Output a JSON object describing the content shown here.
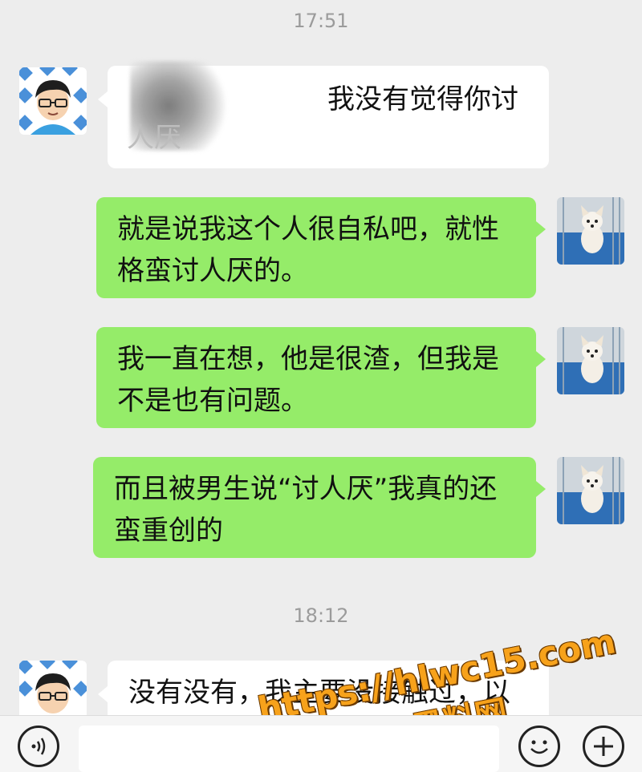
{
  "chat": {
    "timestamp_1": "17:51",
    "msg_1": "我没有觉得你讨",
    "msg_1_line2": "人厌",
    "msg_2_line1": "就是说我这个人很自私吧，就性",
    "msg_2_line2": "格蛮讨人厌的。",
    "msg_3_line1": "我一直在想，他是很渣，但我是",
    "msg_3_line2": "不是也有问题。",
    "msg_4_line1": "而且被男生说“讨人厌”我真的还",
    "msg_4_line2": "蛮重创的",
    "timestamp_2": "18:12",
    "msg_5": "没有没有，我主要没接触过，以"
  },
  "watermark": {
    "url": "https://hlwc15.com",
    "brand": "黑料网"
  },
  "icons": {
    "other_avatar": "cartoon-man-avatar-icon",
    "self_avatar": "dog-photo-avatar-icon",
    "voice": "voice-icon",
    "emoji": "emoji-icon",
    "plus": "plus-icon"
  },
  "colors": {
    "background": "#ededed",
    "sent_bubble": "#95ec69",
    "received_bubble": "#ffffff",
    "watermark": "#f7a21b"
  }
}
